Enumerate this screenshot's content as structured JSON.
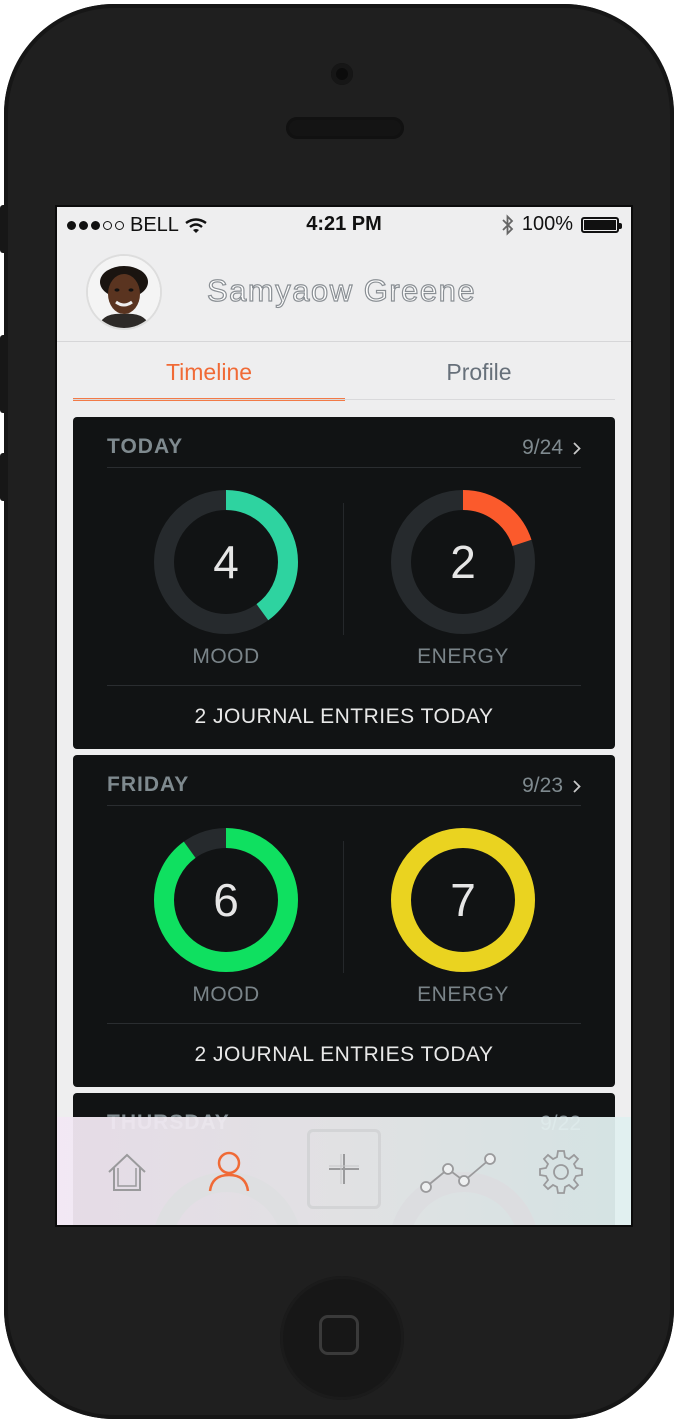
{
  "status_bar": {
    "carrier": "BELL",
    "time": "4:21 PM",
    "battery": "100%"
  },
  "user": {
    "name": "Samyaow Greene"
  },
  "tabs": [
    {
      "label": "Timeline",
      "active": true
    },
    {
      "label": "Profile",
      "active": false
    }
  ],
  "cards": [
    {
      "day": "TODAY",
      "date": "9/24",
      "mood": {
        "value": "4",
        "label": "MOOD",
        "fraction": 0.4,
        "color": "#2ed3a0"
      },
      "energy": {
        "value": "2",
        "label": "ENERGY",
        "fraction": 0.2,
        "color": "#fb5a2c"
      },
      "footer": "2 JOURNAL ENTRIES TODAY"
    },
    {
      "day": "FRIDAY",
      "date": "9/23",
      "mood": {
        "value": "6",
        "label": "MOOD",
        "fraction": 0.9,
        "color": "#0fe060"
      },
      "energy": {
        "value": "7",
        "label": "ENERGY",
        "fraction": 1.0,
        "color": "#ead320"
      },
      "footer": "2 JOURNAL ENTRIES TODAY"
    },
    {
      "day": "THURSDAY",
      "date": "9/22"
    }
  ],
  "bottom_nav": [
    {
      "icon": "home-icon",
      "active": false
    },
    {
      "icon": "profile-icon",
      "active": true,
      "color": "#f06a36"
    },
    {
      "icon": "add-icon",
      "active": false
    },
    {
      "icon": "trends-icon",
      "active": false
    },
    {
      "icon": "settings-icon",
      "active": false
    }
  ],
  "colors": {
    "accent": "#f06a36",
    "card_background": "#111314",
    "track": "#262a2d"
  }
}
